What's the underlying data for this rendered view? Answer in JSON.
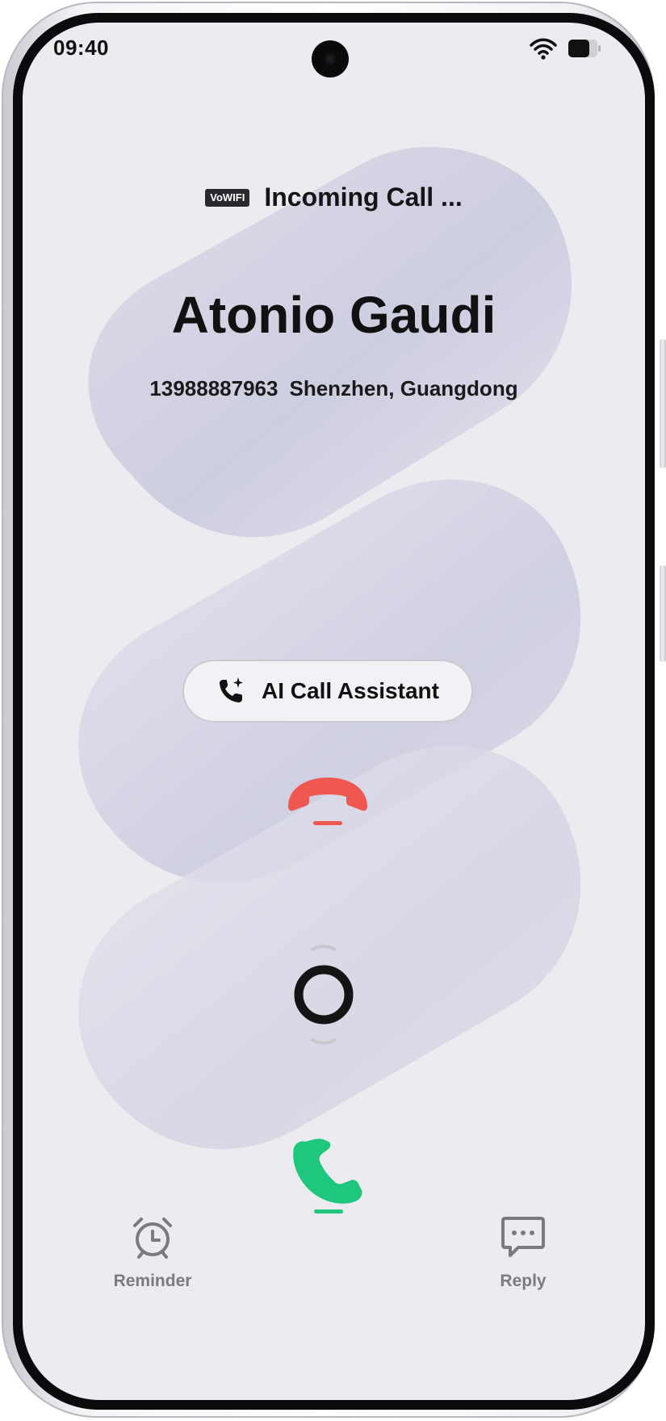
{
  "status_bar": {
    "time": "09:40",
    "wifi_icon": "wifi-icon",
    "battery_icon": "battery-icon"
  },
  "call": {
    "badge": "VoWIFI",
    "status": "Incoming Call ...",
    "caller_name": "Atonio Gaudi",
    "phone_number": "13988887963",
    "location": "Shenzhen, Guangdong"
  },
  "ai_assistant": {
    "label": "AI Call Assistant",
    "icon": "phone-sparkle-icon"
  },
  "controls": {
    "decline_icon": "decline-call-icon",
    "answer_icon": "answer-call-icon",
    "slider_icon": "slider-ring-icon",
    "decline_color": "#f0574f",
    "answer_color": "#1fc77e"
  },
  "actions": {
    "reminder": {
      "label": "Reminder",
      "icon": "alarm-clock-icon"
    },
    "reply": {
      "label": "Reply",
      "icon": "message-bubble-icon"
    }
  },
  "colors": {
    "screen_background": "#ebebf0",
    "shape_tint": "#c7c7de",
    "secondary_text": "#7a7a7f"
  }
}
